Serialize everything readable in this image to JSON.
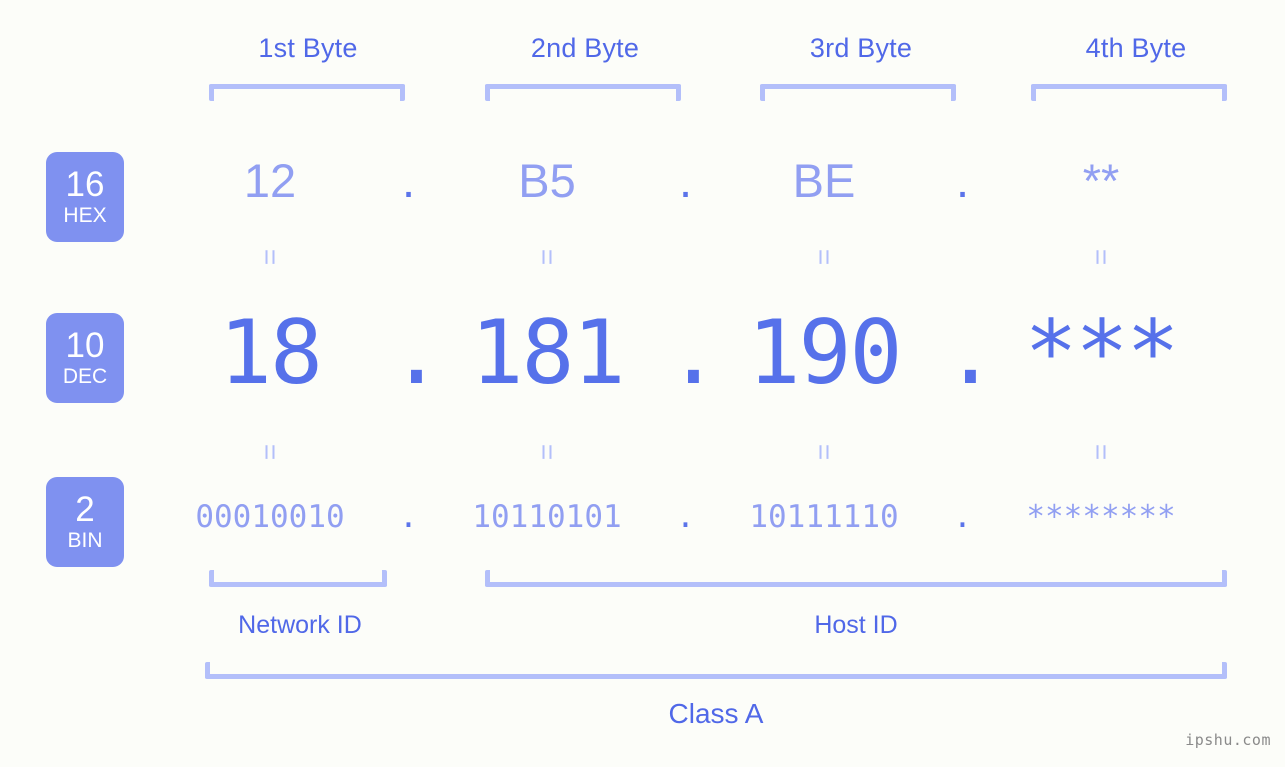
{
  "background_color": "#fcfdf9",
  "accent_colors": {
    "badge_fill": "#7f91f0",
    "badge_text": "#ffffff",
    "header_text": "#5068e8",
    "bracket": "#b3bffa",
    "hex_value": "#919ff2",
    "dec_value": "#5671ea",
    "bin_value": "#919ff2",
    "separator_dot": "#5b74ea",
    "equals": "#b3bffa",
    "watermark": "#8a8a8a"
  },
  "byte_headers": [
    {
      "label": "1st Byte"
    },
    {
      "label": "2nd Byte"
    },
    {
      "label": "3rd Byte"
    },
    {
      "label": "4th Byte"
    }
  ],
  "bases": [
    {
      "number": "16",
      "name": "HEX"
    },
    {
      "number": "10",
      "name": "DEC"
    },
    {
      "number": "2",
      "name": "BIN"
    }
  ],
  "rows": {
    "hex": {
      "base_number": "16",
      "base_name": "HEX",
      "bytes": [
        "12",
        "B5",
        "BE",
        "**"
      ],
      "separator": "."
    },
    "dec": {
      "base_number": "10",
      "base_name": "DEC",
      "bytes": [
        "18",
        "181",
        "190",
        "***"
      ],
      "separator": "."
    },
    "bin": {
      "base_number": "2",
      "base_name": "BIN",
      "bytes": [
        "00010010",
        "10110101",
        "10111110",
        "********"
      ],
      "separator": "."
    }
  },
  "equals_glyph": "=",
  "sections": {
    "network_id": "Network ID",
    "host_id": "Host ID",
    "ip_class": "Class A"
  },
  "watermark": "ipshu.com"
}
